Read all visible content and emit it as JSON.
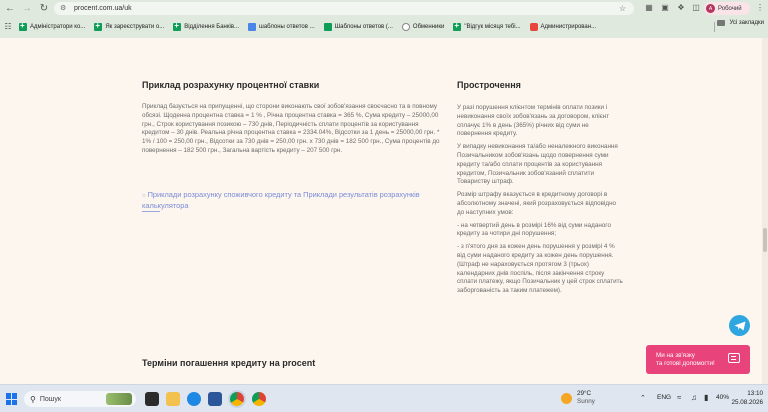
{
  "browser": {
    "url": "procent.com.ua/uk",
    "profile_initial": "A",
    "profile_label": "Робочий",
    "bookmarks": [
      {
        "label": "Адміністратори ко...",
        "icon": "google-sheets-icon"
      },
      {
        "label": "Як зареєструвати о...",
        "icon": "google-sheets-icon"
      },
      {
        "label": "Відділення Банків...",
        "icon": "google-sheets-icon"
      },
      {
        "label": "шаблоны ответов ...",
        "icon": "google-docs-icon"
      },
      {
        "label": "Шаблоны ответов (...",
        "icon": "google-sheets-chart-icon"
      },
      {
        "label": "Обменники",
        "icon": "globe-icon"
      },
      {
        "label": "\"Відгук місяця тебі...",
        "icon": "google-sheets-icon"
      },
      {
        "label": "Администрирован...",
        "icon": "red-square-icon"
      }
    ],
    "all_bookmarks_label": "Усі закладки"
  },
  "content": {
    "example": {
      "title": "Приклад розрахунку процентної ставки",
      "text": "Приклад базується на припущенні, що сторони виконають свої зобов'язання своєчасно та в повному обсязі. Щоденна процентна ставка = 1 % , Річна процентна ставка = 365 %, Сума кредиту – 25000,00 грн., Строк користування позикою – 730 днів, Періодичність сплати процентів за користування кредитом – 30 днів. Реальна річна процентна ставка = 2334.04%, Відсотки за 1 день = 25000,00 грн. * 1% / 100 = 250,00 грн., Відсотки за 730 днів = 250,00 грн. х 730 днів = 182 500 грн., Сума процентів до повернення – 182 500 грн., Загальна вартість кредиту – 207 500 грн.",
      "link_text": "Приклади розрахунку споживчого кредиту та Приклади результатів розрахунків калькулятора"
    },
    "overdue": {
      "title": "Прострочення",
      "paragraphs": [
        "У разі порушення клієнтом термінів оплати позики і невиконання своїх зобов'язань за договором, клієнт сплачує 1% в день (365%) річних від суми не повернення кредиту.",
        "У випадку невиконання та/або неналежного виконання Позичальником зобов'язань щодо повернення суми кредиту та/або сплати процентів за користування кредитом, Позичальник зобов'язаний сплатити Товариству штраф.",
        "Розмір штрафу вказується в кредитному договорі в абсолютному значені, який розраховується відповідно до наступних умов:",
        "- на четвертий день в розмірі 16% від суми наданого кредиту за чотири дні порушення;",
        "- з п'ятого дня за кожен день порушення у розмірі 4 % від суми наданого кредиту за кожен день порушення. (Штраф не нараховується протягом 3 (трьох) календарних днів поспіль, після закінчення строку сплати платежу, якщо Позичальник у цей строк сплатить заборгованість за таким платежем)."
      ]
    },
    "terms": {
      "title": "Терміни погашення кредиту на procent"
    }
  },
  "widgets": {
    "chat_line1": "Ми на зв'язку",
    "chat_line2": "та готові допомогти!"
  },
  "taskbar": {
    "search_placeholder": "Пошук",
    "weather_temp": "29°C",
    "weather_cond": "Sunny",
    "language": "ENG",
    "battery": "40%",
    "time": "13:10",
    "date": "25.08.2026"
  },
  "colors": {
    "page_bg": "#fdf6ee",
    "link": "#7a8bd8",
    "chat_widget": "#e8437a",
    "telegram": "#2ea6e0"
  }
}
